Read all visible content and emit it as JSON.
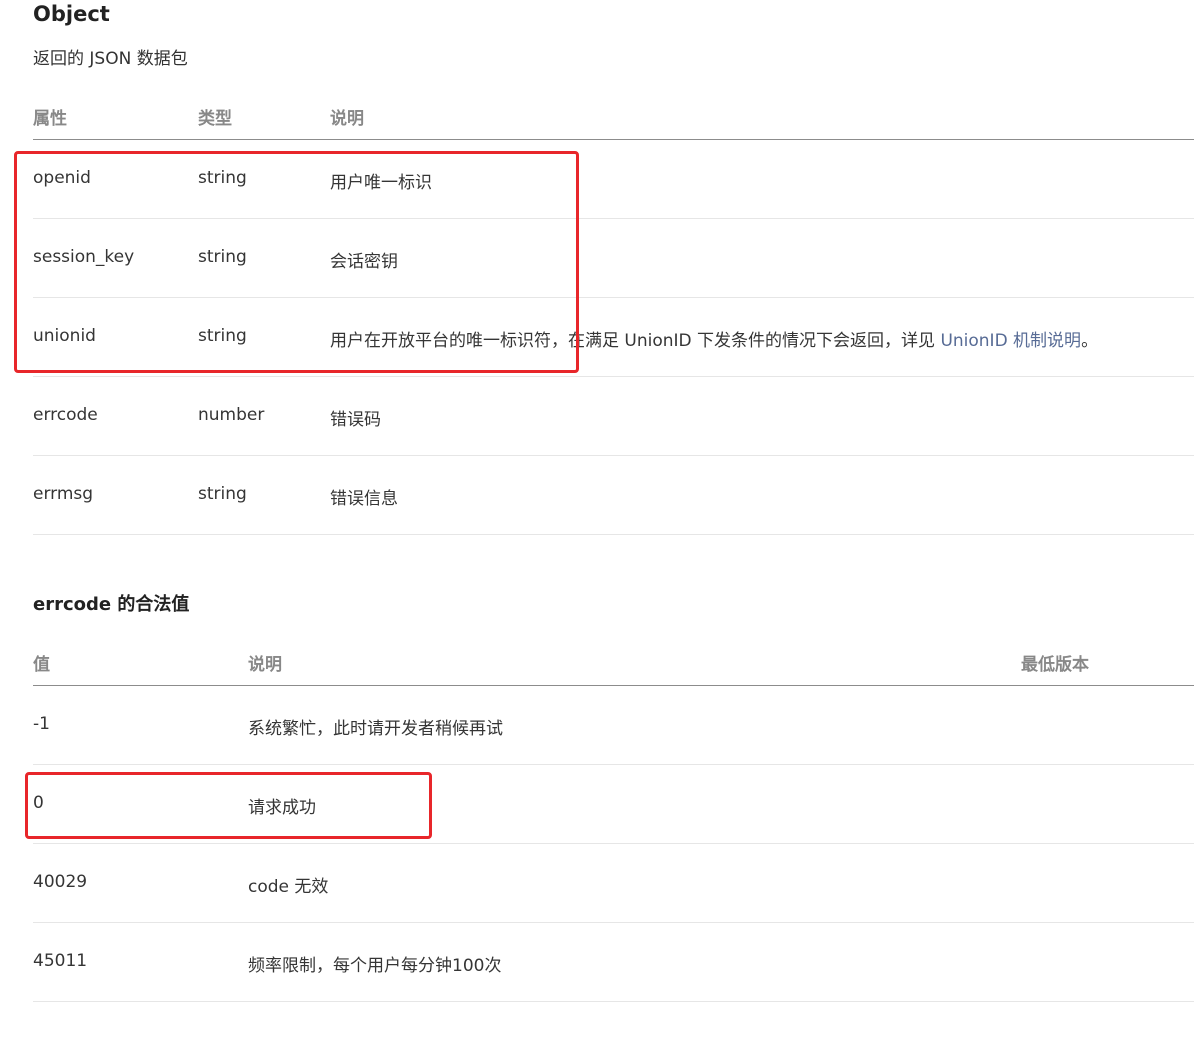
{
  "object_section": {
    "title": "Object",
    "subtitle": "返回的 JSON 数据包",
    "headers": [
      "属性",
      "类型",
      "说明"
    ],
    "rows": [
      {
        "name": "openid",
        "type": "string",
        "desc": "用户唯一标识"
      },
      {
        "name": "session_key",
        "type": "string",
        "desc": "会话密钥"
      },
      {
        "name": "unionid",
        "type": "string",
        "desc": "用户在开放平台的唯一标识符，在满足 UnionID 下发条件的情况下会返回，详见 ",
        "link": "UnionID 机制说明",
        "tail": "。"
      },
      {
        "name": "errcode",
        "type": "number",
        "desc": "错误码"
      },
      {
        "name": "errmsg",
        "type": "string",
        "desc": "错误信息"
      }
    ]
  },
  "errcode_section": {
    "title": "errcode 的合法值",
    "headers": [
      "值",
      "说明",
      "最低版本"
    ],
    "rows": [
      {
        "value": "-1",
        "desc": "系统繁忙，此时请开发者稍候再试",
        "version": ""
      },
      {
        "value": "0",
        "desc": "请求成功",
        "version": ""
      },
      {
        "value": "40029",
        "desc": "code 无效",
        "version": ""
      },
      {
        "value": "45011",
        "desc": "频率限制，每个用户每分钟100次",
        "version": ""
      }
    ]
  },
  "colors": {
    "highlight": "#e8262a",
    "link": "#576b95",
    "header_text": "#888888"
  }
}
